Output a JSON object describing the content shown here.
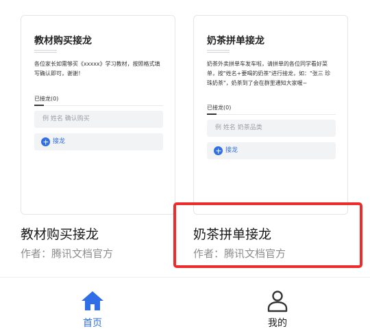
{
  "templates": [
    {
      "card_title": "教材购买接龙",
      "card_desc": "各位家长如需够买《xxxxx》学习教材，按照格式填\n写确认即可，谢谢！",
      "count_label": "已接龙(0)",
      "input_placeholder": "例  姓名   确认购买",
      "add_label": "接龙",
      "title": "教材购买接龙",
      "author": "作者：腾讯文档官方"
    },
    {
      "card_title": "奶茶拼单接龙",
      "card_desc": "奶茶外卖拼单车发车啦，请拼单的各位同学看好菜\n单，按\"姓名+要喝的奶茶\"进行接龙，如：\"张三 珍\n珠奶茶\"，奶茶到了会在群里通知大家喔~",
      "count_label": "已接龙(0)",
      "input_placeholder": "例  姓名   奶茶品类",
      "add_label": "接龙",
      "title": "奶茶拼单接龙",
      "author": "作者：腾讯文档官方"
    }
  ],
  "tabs": [
    {
      "label": "首页",
      "icon": "home-icon",
      "active": true
    },
    {
      "label": "我的",
      "icon": "person-icon",
      "active": false
    }
  ],
  "colors": {
    "accent": "#2f6ee6",
    "highlight": "#ee2b2b"
  }
}
